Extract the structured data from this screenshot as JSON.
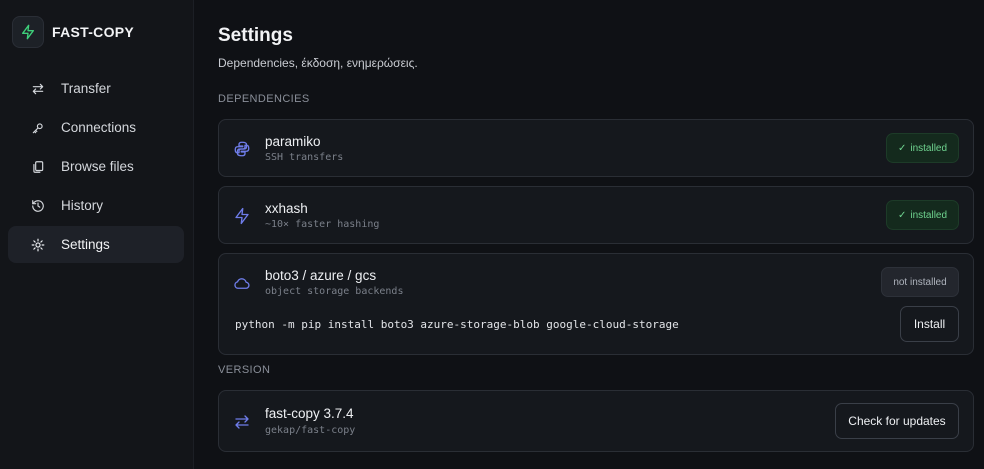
{
  "app": {
    "name": "FAST-COPY"
  },
  "colors": {
    "accent": "#6f7dea",
    "brand": "#3ecf7a",
    "installed": "#6fd38f"
  },
  "sidebar": {
    "items": [
      {
        "label": "Transfer",
        "icon": "arrows-swap-icon"
      },
      {
        "label": "Connections",
        "icon": "key-icon"
      },
      {
        "label": "Browse files",
        "icon": "files-icon"
      },
      {
        "label": "History",
        "icon": "history-icon"
      },
      {
        "label": "Settings",
        "icon": "gear-icon",
        "active": true
      }
    ]
  },
  "page": {
    "title": "Settings",
    "subtitle": "Dependencies, έκδοση, ενημερώσεις."
  },
  "dependencies": {
    "section_label": "DEPENDENCIES",
    "items": [
      {
        "name": "paramiko",
        "desc": "SSH transfers",
        "status": "installed",
        "icon": "python-icon"
      },
      {
        "name": "xxhash",
        "desc": "~10× faster hashing",
        "status": "installed",
        "icon": "bolt-icon"
      },
      {
        "name": "boto3 / azure / gcs",
        "desc": "object storage backends",
        "status": "not installed",
        "icon": "cloud-icon",
        "command": "python -m pip install boto3 azure-storage-blob google-cloud-storage",
        "install_label": "Install"
      }
    ]
  },
  "version": {
    "section_label": "VERSION",
    "name": "fast-copy 3.7.4",
    "repo": "gekap/fast-copy",
    "icon": "arrows-swap-icon",
    "check_label": "Check for updates"
  }
}
